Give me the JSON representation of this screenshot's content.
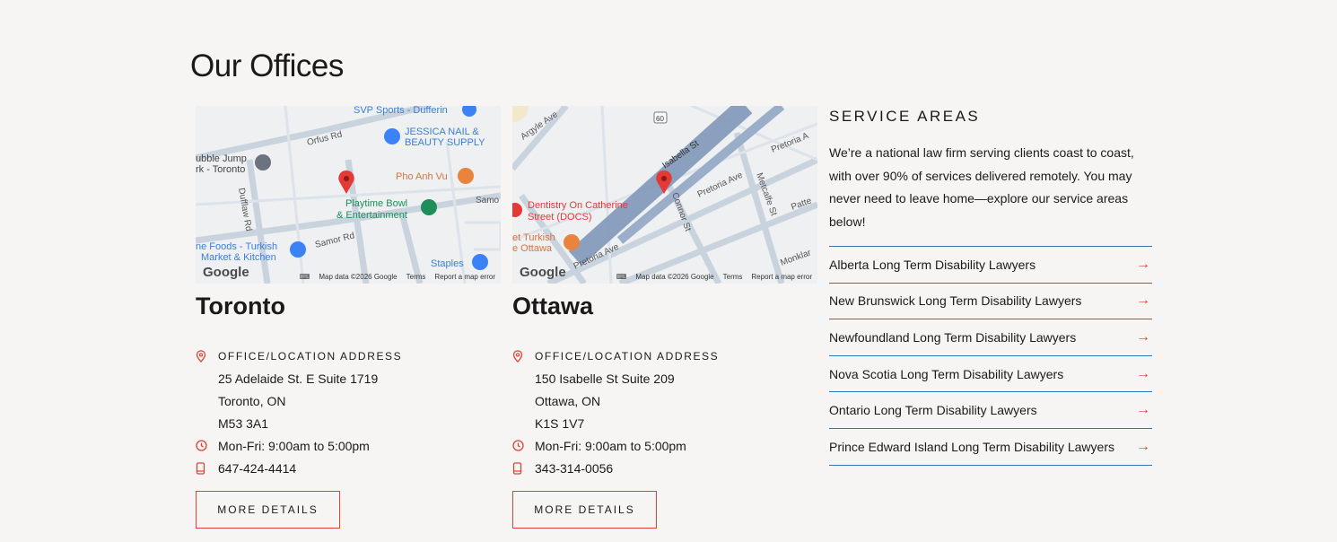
{
  "section_title": "Our Offices",
  "offices": [
    {
      "city": "Toronto",
      "address_label": "OFFICE/LOCATION ADDRESS",
      "address_line1": "25 Adelaide St. E Suite 1719",
      "address_line2": "Toronto, ON",
      "postal": "M53 3A1",
      "hours": "Mon-Fri: 9:00am to 5:00pm",
      "phone": "647-424-4414",
      "button": "MORE DETAILS",
      "map": {
        "google": "Google",
        "data": "Map data ©2026 Google",
        "terms": "Terms",
        "report": "Report a map error",
        "labels": [
          "SVP Sports - Dufferin",
          "JESSICA NAIL &",
          "BEAUTY SUPPLY",
          "Orfus Rd",
          "ubble Jump",
          "rk - Toronto",
          "Pho Anh Vu",
          "Playtime Bowl",
          "& Entertainment",
          "Dufflaw Rd",
          "Samor Rd",
          "Samo",
          "ne Foods - Turkish",
          "Market & Kitchen",
          "Staples"
        ]
      }
    },
    {
      "city": "Ottawa",
      "address_label": "OFFICE/LOCATION ADDRESS",
      "address_line1": "150 Isabelle St Suite 209",
      "address_line2": "Ottawa, ON",
      "postal": "K1S 1V7",
      "hours": "Mon-Fri: 9:00am to 5:00pm",
      "phone": "343-314-0056",
      "button": "MORE DETAILS",
      "map": {
        "google": "Google",
        "data": "Map data ©2026 Google",
        "terms": "Terms",
        "report": "Report a map error",
        "labels": [
          "Argyle Ave",
          "60",
          "Isabella St",
          "Pretoria A",
          "Dentistry On Catherine",
          "Street (DOCS)",
          "Connor St",
          "Pretoria Ave",
          "Metcalfe St",
          "Patte",
          "et Turkish",
          "e Ottawa",
          "Pretoria Ave",
          "Monklar"
        ]
      }
    }
  ],
  "service_areas": {
    "title": "SERVICE AREAS",
    "description": "We’re a national law firm serving clients coast to coast, with over 90% of services delivered remotely. You may never need to leave home—explore our service areas below!",
    "links": [
      "Alberta Long Term Disability Lawyers",
      "New Brunswick Long Term Disability Lawyers",
      "Newfoundland Long Term Disability Lawyers",
      "Nova Scotia Long Term Disability Lawyers",
      "Ontario Long Term Disability Lawyers",
      "Prince Edward Island Long Term Disability Lawyers"
    ],
    "arrow": "→"
  },
  "colors": {
    "accent": "#d9433a",
    "link_border": "#2f78b7",
    "background": "#f7f5f3"
  }
}
